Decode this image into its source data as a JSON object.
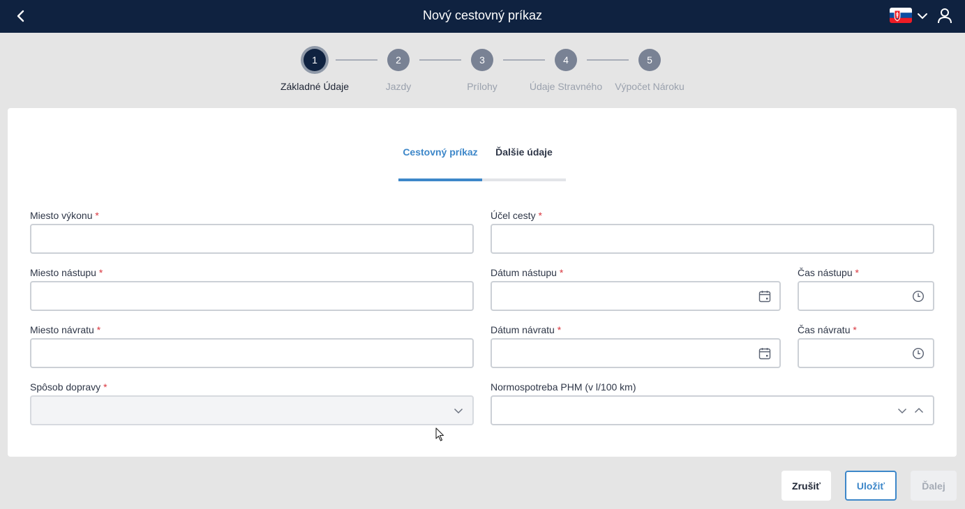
{
  "header": {
    "title": "Nový cestovný príkaz",
    "language": "SK"
  },
  "stepper": {
    "steps": [
      {
        "number": "1",
        "label": "Základné Údaje",
        "active": true
      },
      {
        "number": "2",
        "label": "Jazdy",
        "active": false
      },
      {
        "number": "3",
        "label": "Prílohy",
        "active": false
      },
      {
        "number": "4",
        "label": "Údaje Stravného",
        "active": false
      },
      {
        "number": "5",
        "label": "Výpočet Nároku",
        "active": false
      }
    ]
  },
  "tabs": [
    {
      "label": "Cestovný príkaz",
      "active": true
    },
    {
      "label": "Ďalšie údaje",
      "active": false
    }
  ],
  "form": {
    "miesto_vykonu": {
      "label": "Miesto výkonu",
      "value": ""
    },
    "ucel_cesty": {
      "label": "Účel cesty",
      "value": ""
    },
    "miesto_nastupu": {
      "label": "Miesto nástupu",
      "value": ""
    },
    "datum_nastupu": {
      "label": "Dátum nástupu",
      "value": ""
    },
    "cas_nastupu": {
      "label": "Čas nástupu",
      "value": ""
    },
    "miesto_navratu": {
      "label": "Miesto návratu",
      "value": ""
    },
    "datum_navratu": {
      "label": "Dátum návratu",
      "value": ""
    },
    "cas_navratu": {
      "label": "Čas návratu",
      "value": ""
    },
    "sposob_dopravy": {
      "label": "Spôsob dopravy",
      "value": ""
    },
    "normospotreba": {
      "label": "Normospotreba PHM (v l/100 km)",
      "value": ""
    },
    "required_mark": "*"
  },
  "actions": {
    "cancel": "Zrušiť",
    "save": "Uložiť",
    "next": "Ďalej"
  },
  "colors": {
    "header_bg": "#0f2240",
    "accent": "#3d87c9",
    "required": "#d9363e",
    "page_bg": "#e5e5e5"
  },
  "icons": [
    "back-icon",
    "slovak-flag-icon",
    "chevron-down-icon",
    "user-icon",
    "calendar-icon",
    "clock-icon",
    "chevron-up-icon",
    "mouse-cursor-icon"
  ]
}
